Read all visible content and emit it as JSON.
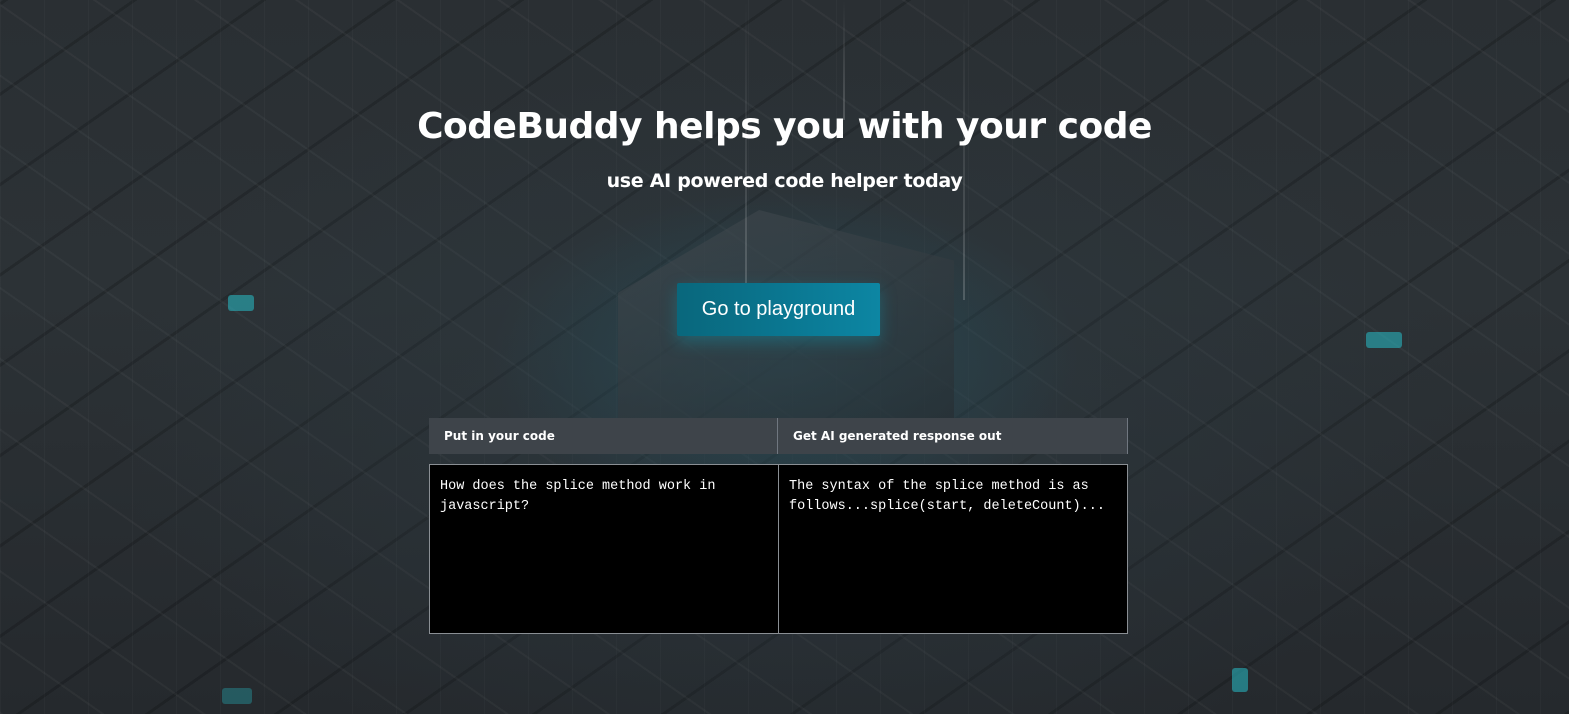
{
  "hero": {
    "title": "CodeBuddy helps you with your code",
    "subtitle": "use AI powered code helper today",
    "cta_label": "Go to playground"
  },
  "panels": {
    "input": {
      "header": "Put in your code",
      "text": "How does the splice method work in javascript?"
    },
    "output": {
      "header": "Get AI generated response out",
      "text": "The syntax of the splice method is as follows...splice(start, deleteCount)..."
    }
  },
  "colors": {
    "background": "#23282c",
    "button": "#0a7690",
    "panel_header": "#3e444a",
    "code_box": "#000000"
  }
}
